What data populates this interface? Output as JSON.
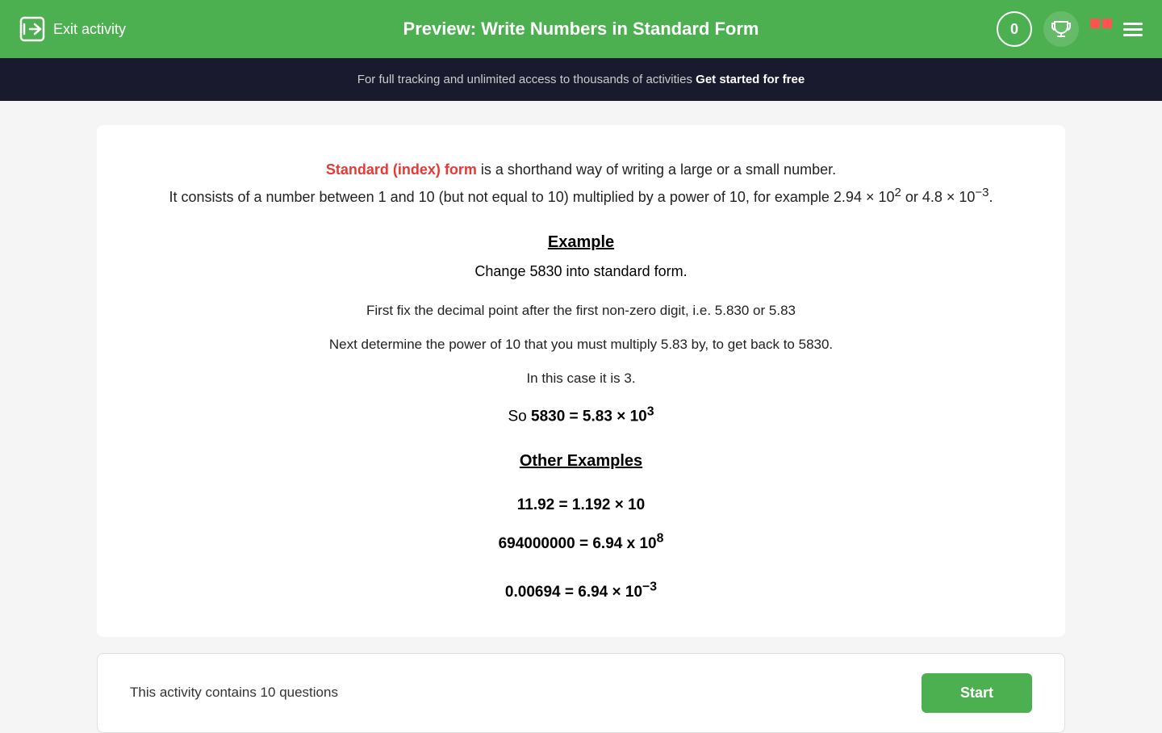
{
  "header": {
    "exit_label": "Exit activity",
    "title": "Preview: Write Numbers in Standard Form",
    "score": "0"
  },
  "banner": {
    "text": "For full tracking and unlimited access to thousands of activities ",
    "cta": "Get started for free"
  },
  "content": {
    "intro_part1": " is a shorthand way of writing a large or a small number.",
    "intro_highlight": "Standard (index) form",
    "intro_part2": "It consists of a number between 1 and 10 (but not equal to 10) multiplied by a power of 10, for example 2.94 × 10",
    "sup1": "2",
    "intro_part3": " or 4.8 × 10",
    "sup2": "−3",
    "intro_part4": ".",
    "example_heading": "Example",
    "example_question": "Change 5830 into standard form.",
    "step1": "First fix the decimal point after the first non-zero digit, i.e. 5.830 or 5.83",
    "step2": "Next determine the power of 10 that you must multiply 5.83 by, to get back to 5830.",
    "step3": "In this case it is 3.",
    "result_prefix": "So ",
    "result_bold": "5830 = 5.83 × 10",
    "result_sup": "3",
    "other_heading": "Other Examples",
    "ex1": "11.92 = 1.192 × 10",
    "ex2_prefix": "694000000 = 6.94 x 10",
    "ex2_sup": "8",
    "ex3_prefix": "0.00694 = 6.94 × 10",
    "ex3_sup": "−3"
  },
  "bottom": {
    "questions_label": "This activity contains 10 questions",
    "start_label": "Start"
  }
}
